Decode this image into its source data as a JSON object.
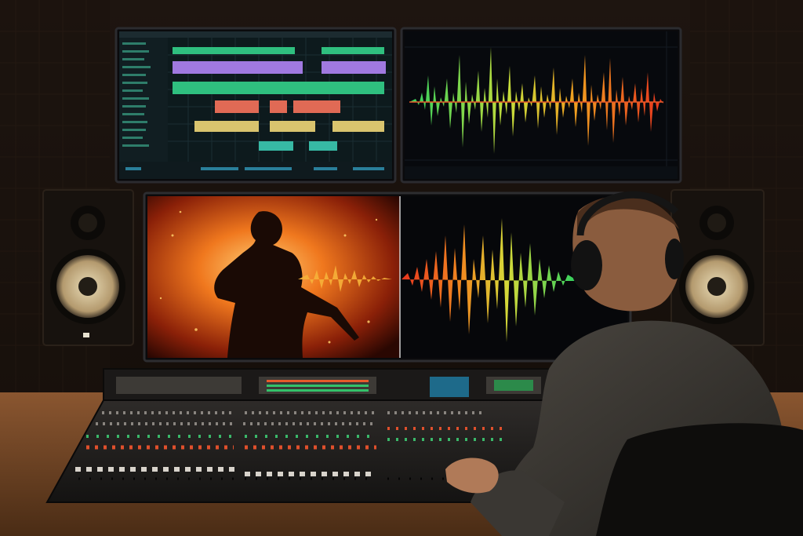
{
  "scene": {
    "subject": "audio-engineer",
    "room": {
      "wall_color": "#1a120d",
      "desk_color": "#6a4123"
    },
    "daw_screen": {
      "tracks": [
        {
          "color": "#2fbf7f"
        },
        {
          "color": "#a079e0"
        },
        {
          "color": "#2fbf7f"
        },
        {
          "color": "#e06a55"
        },
        {
          "color": "#d9c46e"
        },
        {
          "color": "#37b9a4"
        }
      ]
    },
    "wave_gradient": [
      "#33d15e",
      "#c8dc3a",
      "#f0a020",
      "#e8361e"
    ],
    "movie_frame": {
      "fire_colors": [
        "#ffb347",
        "#e8591a",
        "#3a0c04"
      ]
    }
  }
}
